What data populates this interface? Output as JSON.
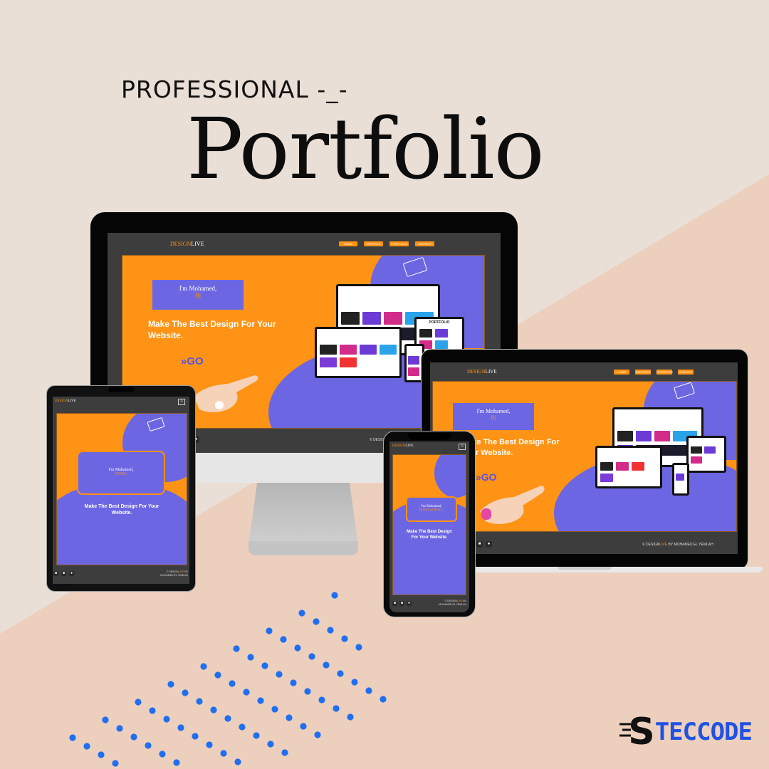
{
  "header": {
    "kicker": "PROFESSIONAL -_-",
    "title": "Portfolio"
  },
  "site": {
    "logo_design": "DESIGN",
    "logo_live": "LIVE",
    "nav": [
      "HOME",
      "SERVICES",
      "PORTFOLIO",
      "CONTACT"
    ],
    "intro_line": "I'm Mohamed,",
    "desktop_role": "B|",
    "laptop_role": "B|",
    "tablet_role": "HTML|",
    "phone_role": "Bootstrap React |",
    "tagline": "Make The Best Design For Your Website.",
    "go_label": "GO",
    "go_icon": "double-chevron-right",
    "footer_prefix": "© DESIGN",
    "footer_live": "LIVE",
    "footer_by": "BY MOHAMED EL YEMLAH",
    "footer_partial": "© DESIG",
    "menu_icon": "hamburger",
    "social_icons": [
      "linkedin",
      "instagram",
      "github"
    ]
  },
  "mini_site": {
    "title": "PORTFOLIO"
  },
  "brand": {
    "mark": "S",
    "name": "TECCODE"
  },
  "colors": {
    "orange": "#ff9111",
    "purple": "#6c66e3",
    "dark": "#3d3d3d",
    "dots": "#1f6ff0"
  }
}
